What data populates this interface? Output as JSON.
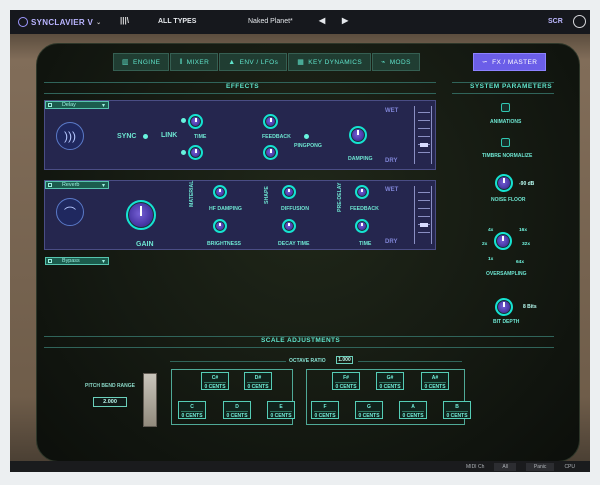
{
  "topbar": {
    "brand": "SYNCLAVIER V",
    "library_icon": "library-icon",
    "type_filter": "ALL TYPES",
    "preset": "Naked Planet*",
    "prev_arrow": "◀",
    "next_arrow": "▶",
    "mode": "SCR",
    "user_icon": "user-icon"
  },
  "tabs": [
    {
      "label": "ENGINE",
      "icon": "engine-icon"
    },
    {
      "label": "MIXER",
      "icon": "mixer-icon"
    },
    {
      "label": "ENV / LFOs",
      "icon": "wave-icon"
    },
    {
      "label": "KEY DYNAMICS",
      "icon": "key-dynamics-icon"
    },
    {
      "label": "MODS",
      "icon": "mods-icon"
    },
    {
      "label": "FX / MASTER",
      "icon": "fx-icon"
    }
  ],
  "effects": {
    "title": "EFFECTS",
    "delay": {
      "selector": "Delay",
      "sync": "SYNC",
      "link": "LINK",
      "time": "TIME",
      "feedback": "FEEDBACK",
      "pingpong": "PINGPONG",
      "damping": "DAMPING",
      "wet": "WET",
      "dry": "DRY"
    },
    "reverb": {
      "selector": "Reverb",
      "gain": "GAIN",
      "material": "MATERIAL",
      "hf_damping": "HF DAMPING",
      "brightness": "BRIGHTNESS",
      "shape": "SHAPE",
      "diffusion": "DIFFUSION",
      "decay_time": "DECAY TIME",
      "pre_delay": "PRE-DELAY",
      "feedback": "FEEDBACK",
      "time": "TIME",
      "wet": "WET",
      "dry": "DRY"
    },
    "bypass": "Bypass"
  },
  "system": {
    "title": "SYSTEM PARAMETERS",
    "animations": "ANIMATIONS",
    "timbre": "TIMBRE NORMALIZE",
    "noise_value": "-90 dB",
    "noise_floor": "NOISE FLOOR",
    "oversampling_values": [
      "4x",
      "16x",
      "2x",
      "32x",
      "1x",
      "64x"
    ],
    "oversampling": "OVERSAMPLING",
    "bit_value": "8 Bits",
    "bit_depth": "BIT DEPTH"
  },
  "scale": {
    "title": "SCALE ADJUSTMENTS",
    "octave_ratio": "OCTAVE RATIO",
    "octave_value": "1.000",
    "pitch_bend_range": "PITCH BEND RANGE",
    "pitch_bend_value": "2.000",
    "cents_label": "0 CENTS",
    "sharp_keys": [
      "C#",
      "D#",
      "F#",
      "G#",
      "A#"
    ],
    "natural_keys": [
      "C",
      "D",
      "E",
      "F",
      "G",
      "A",
      "B"
    ]
  },
  "bottom": {
    "midi_label": "MIDI Ch",
    "midi_value": "All",
    "panic": "Panic",
    "cpu": "CPU"
  }
}
